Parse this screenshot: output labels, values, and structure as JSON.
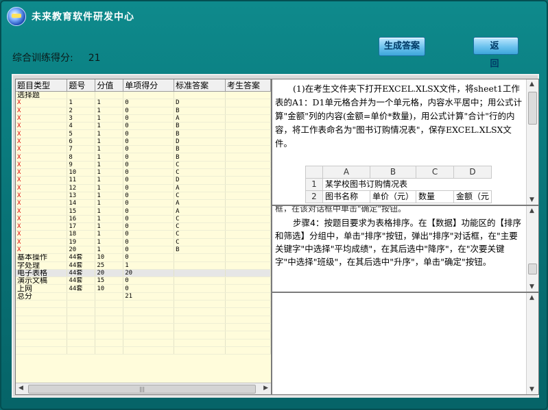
{
  "window": {
    "title": "未来教育软件研发中心"
  },
  "score": {
    "label": "综合训练得分:",
    "value": "21"
  },
  "buttons": {
    "generate": "生成答案",
    "back": "返  回"
  },
  "table": {
    "headers": [
      "题目类型",
      "题号",
      "分值",
      "单项得分",
      "标准答案",
      "考生答案"
    ],
    "section_title": "选择题",
    "mc_rows": [
      {
        "mark": "X",
        "num": "1",
        "val": "1",
        "score": "0",
        "ans": "D"
      },
      {
        "mark": "X",
        "num": "2",
        "val": "1",
        "score": "0",
        "ans": "B"
      },
      {
        "mark": "X",
        "num": "3",
        "val": "1",
        "score": "0",
        "ans": "A"
      },
      {
        "mark": "X",
        "num": "4",
        "val": "1",
        "score": "0",
        "ans": "B"
      },
      {
        "mark": "X",
        "num": "5",
        "val": "1",
        "score": "0",
        "ans": "B"
      },
      {
        "mark": "X",
        "num": "6",
        "val": "1",
        "score": "0",
        "ans": "D"
      },
      {
        "mark": "X",
        "num": "7",
        "val": "1",
        "score": "0",
        "ans": "B"
      },
      {
        "mark": "X",
        "num": "8",
        "val": "1",
        "score": "0",
        "ans": "B"
      },
      {
        "mark": "X",
        "num": "9",
        "val": "1",
        "score": "0",
        "ans": "C"
      },
      {
        "mark": "X",
        "num": "10",
        "val": "1",
        "score": "0",
        "ans": "C"
      },
      {
        "mark": "X",
        "num": "11",
        "val": "1",
        "score": "0",
        "ans": "D"
      },
      {
        "mark": "X",
        "num": "12",
        "val": "1",
        "score": "0",
        "ans": "A"
      },
      {
        "mark": "X",
        "num": "13",
        "val": "1",
        "score": "0",
        "ans": "C"
      },
      {
        "mark": "X",
        "num": "14",
        "val": "1",
        "score": "0",
        "ans": "A"
      },
      {
        "mark": "X",
        "num": "15",
        "val": "1",
        "score": "0",
        "ans": "A"
      },
      {
        "mark": "X",
        "num": "16",
        "val": "1",
        "score": "0",
        "ans": "C"
      },
      {
        "mark": "X",
        "num": "17",
        "val": "1",
        "score": "0",
        "ans": "C"
      },
      {
        "mark": "X",
        "num": "18",
        "val": "1",
        "score": "0",
        "ans": "C"
      },
      {
        "mark": "X",
        "num": "19",
        "val": "1",
        "score": "0",
        "ans": "C"
      },
      {
        "mark": "X",
        "num": "20",
        "val": "1",
        "score": "0",
        "ans": "B"
      }
    ],
    "op_rows": [
      {
        "type": "基本操作",
        "num": "44套",
        "val": "10",
        "score": "0"
      },
      {
        "type": "字处理",
        "num": "44套",
        "val": "25",
        "score": "1"
      },
      {
        "type": "电子表格",
        "num": "44套",
        "val": "20",
        "score": "20"
      },
      {
        "type": "演示文稿",
        "num": "44套",
        "val": "15",
        "score": "0"
      },
      {
        "type": "上网",
        "num": "44套",
        "val": "10",
        "score": "0"
      }
    ],
    "total": {
      "label": "总分",
      "score": "21"
    }
  },
  "question": {
    "text": "(1)在考生文件夹下打开EXCEL.XLSX文件，将sheet1工作表的A1：D1单元格合并为一个单元格，内容水平居中；用公式计算\"金额\"列的内容(金额=单价*数量)，用公式计算\"合计\"行的内容，将工作表命名为\"图书订购情况表\"，保存EXCEL.XLSX文件。",
    "excel": {
      "cols": [
        "A",
        "B",
        "C",
        "D"
      ],
      "rows": [
        {
          "n": "1",
          "a": "某学校图书订购情况表",
          "b": "",
          "c": "",
          "d": ""
        },
        {
          "n": "2",
          "a": "图书名称",
          "b": "单价（元）",
          "c": "数量",
          "d": "金额（元"
        }
      ]
    }
  },
  "steps": {
    "cut_line": "框，在该对话框中单击\"确定\"按钮。",
    "text": "步骤4：按题目要求为表格排序。在【数据】功能区的【排序和筛选】分组中，单击\"排序\"按钮，弹出\"排序\"对话框，在\"主要关键字\"中选择\"平均成绩\"，在其后选中\"降序\"，在\"次要关键字\"中选择\"班级\"，在其后选中\"升序\"，单击\"确定\"按钮。"
  },
  "colors": {
    "background": "#0a7b7e",
    "mark_wrong": "#e00000",
    "table_bg": "#fffcdb"
  }
}
